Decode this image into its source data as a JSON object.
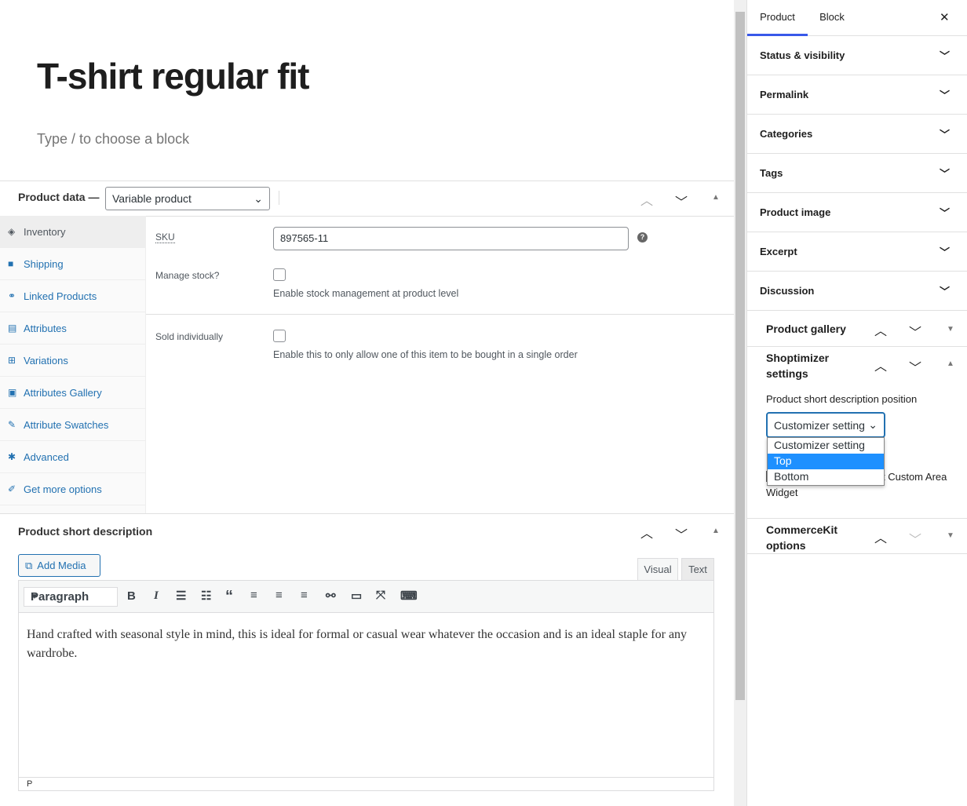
{
  "editor": {
    "title": "T-shirt regular fit",
    "block_placeholder": "Type / to choose a block"
  },
  "product_data": {
    "label": "Product data —",
    "type": "Variable product",
    "tabs": [
      {
        "label": "Inventory",
        "icon": "tag-icon"
      },
      {
        "label": "Shipping",
        "icon": "truck-icon"
      },
      {
        "label": "Linked Products",
        "icon": "link-icon"
      },
      {
        "label": "Attributes",
        "icon": "list-icon"
      },
      {
        "label": "Variations",
        "icon": "grid-icon"
      },
      {
        "label": "Attributes Gallery",
        "icon": "image-icon"
      },
      {
        "label": "Attribute Swatches",
        "icon": "pin-icon"
      },
      {
        "label": "Advanced",
        "icon": "gear-icon"
      },
      {
        "label": "Get more options",
        "icon": "plugin-icon"
      }
    ],
    "sku_label": "SKU",
    "sku_value": "897565-11",
    "manage_stock_label": "Manage stock?",
    "manage_stock_desc": "Enable stock management at product level",
    "sold_ind_label": "Sold individually",
    "sold_ind_desc": "Enable this to only allow one of this item to be bought in a single order"
  },
  "short_desc": {
    "title": "Product short description",
    "add_media": "Add Media",
    "tab_visual": "Visual",
    "tab_text": "Text",
    "format": "Paragraph",
    "content": "Hand crafted with seasonal style in mind, this is ideal for formal or casual wear whatever the occasion and is an ideal staple for any wardrobe.",
    "path": "P"
  },
  "sidebar": {
    "tab_product": "Product",
    "tab_block": "Block",
    "close": "✕",
    "sections": [
      "Status & visibility",
      "Permalink",
      "Categories",
      "Tags",
      "Product image",
      "Excerpt",
      "Discussion"
    ],
    "gallery": "Product gallery",
    "shoptimizer": "Shoptimizer settings",
    "position_label": "Product short description position",
    "position_value": "Customizer setting",
    "options": [
      "Customizer setting",
      "Top",
      "Bottom"
    ],
    "highlighted": "Top",
    "checkbox_label_visible": "t Custom Area",
    "checkbox_label_2": "Widget",
    "commercekit": "CommerceKit options"
  },
  "colors": {
    "accent": "#2271b1",
    "highlight": "#1e90ff",
    "tab_underline": "#3858e9"
  }
}
